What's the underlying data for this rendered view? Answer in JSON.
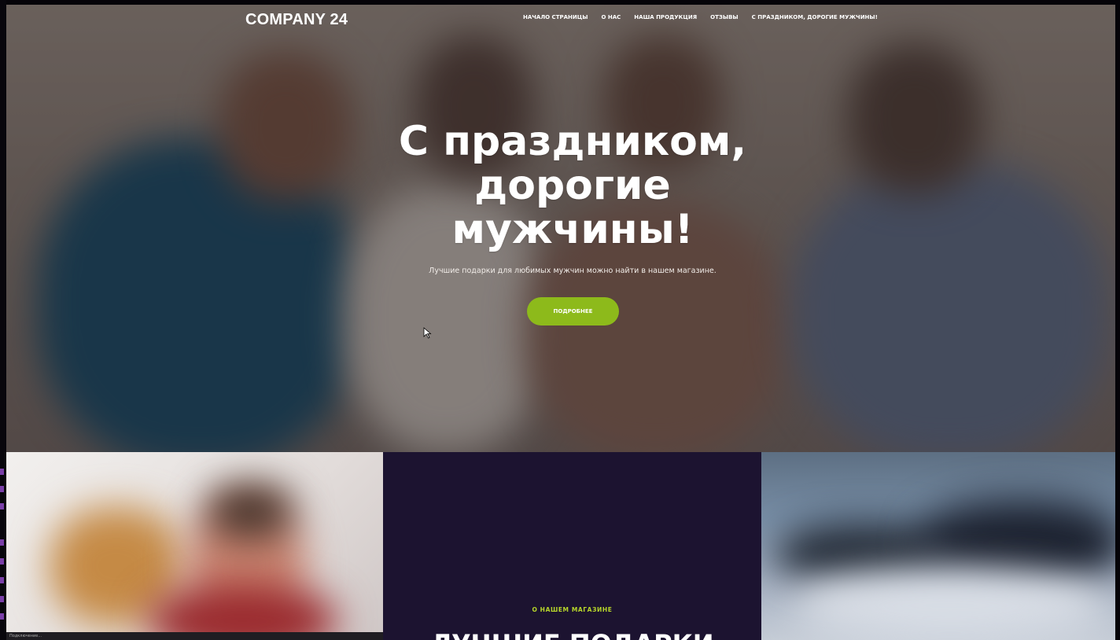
{
  "header": {
    "logo": "COMPANY 24",
    "nav": [
      "НАЧАЛО СТРАНИЦЫ",
      "О НАС",
      "НАША ПРОДУКЦИЯ",
      "ОТЗЫВЫ",
      "С ПРАЗДНИКОМ, ДОРОГИЕ МУЖЧИНЫ!"
    ]
  },
  "hero": {
    "title_line1": "С праздником,",
    "title_line2": "дорогие",
    "title_line3": "мужчины!",
    "subtitle": "Лучшие подарки для любимых мужчин можно найти в нашем магазине.",
    "button": "ПОДРОБНЕЕ"
  },
  "about": {
    "label": "О НАШЕМ МАГАЗИНЕ",
    "heading": "ЛУЧШИЕ ПОДАРКИ"
  },
  "cookie_bar": {
    "text": "Подключение..."
  },
  "colors": {
    "accent": "#8dba1b",
    "panel_dark": "#1c1330",
    "label_green": "#b7d62a"
  }
}
